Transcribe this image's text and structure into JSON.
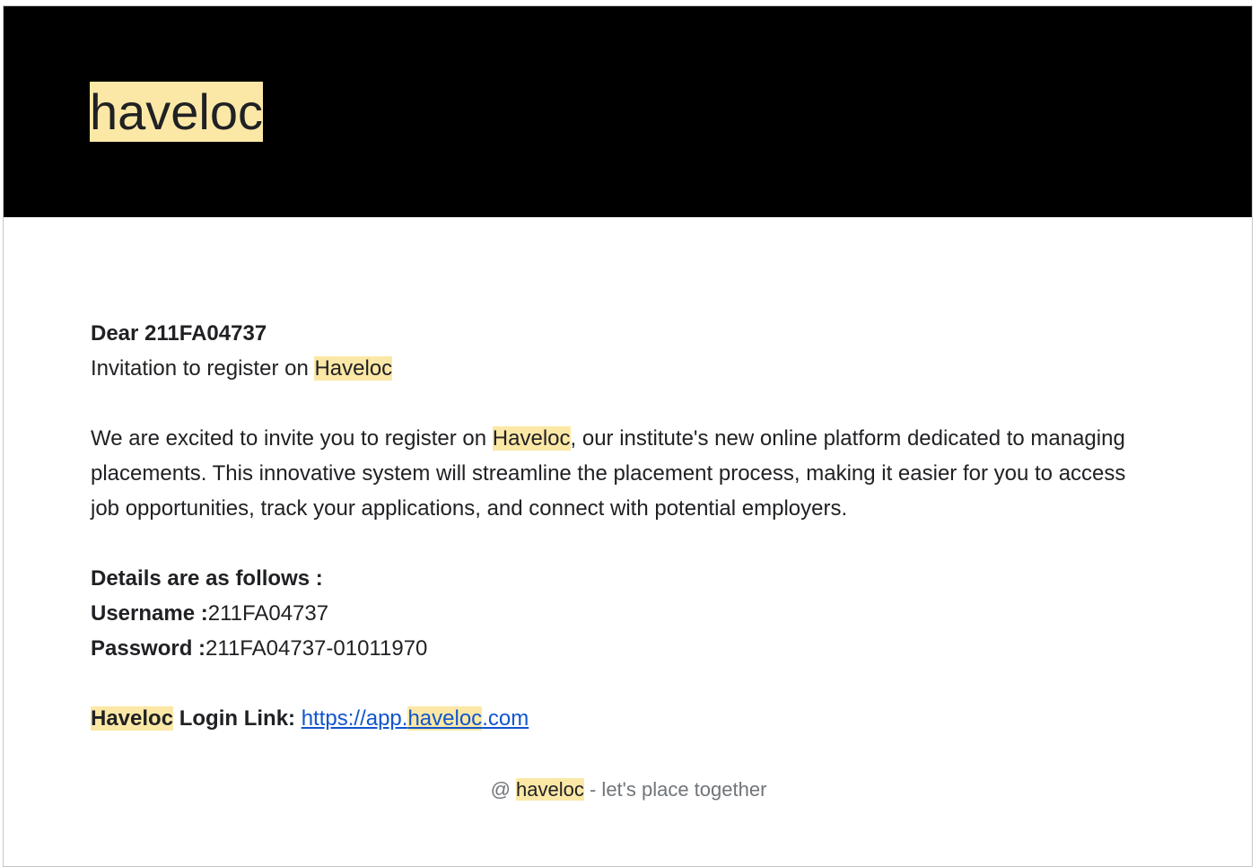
{
  "header": {
    "logo_text": "haveloc"
  },
  "greeting": {
    "prefix": "Dear ",
    "recipient": "211FA04737"
  },
  "invitation": {
    "text": "Invitation to register on ",
    "brand": "Haveloc"
  },
  "intro": {
    "before": "We are excited to invite you to register on ",
    "brand": "Haveloc",
    "after": ", our institute's new online platform dedicated to managing placements. This innovative system will streamline the placement process, making it easier for you to access job opportunities, track your applications, and connect with potential employers."
  },
  "details": {
    "heading": "Details are as follows :",
    "username_label": "Username :",
    "username_value": "211FA04737",
    "password_label": "Password :",
    "password_value": "211FA04737-01011970"
  },
  "login": {
    "brand": "Haveloc",
    "label": " Login Link: ",
    "url_prefix": "https://app.",
    "url_brand": "haveloc",
    "url_suffix": ".com"
  },
  "footer": {
    "prefix": "@ ",
    "brand": "haveloc",
    "tagline": " - let's place together"
  },
  "colors": {
    "header_bg": "#000000",
    "highlight": "#fce8a6",
    "link": "#1155cc",
    "footer_text": "#70757a"
  }
}
